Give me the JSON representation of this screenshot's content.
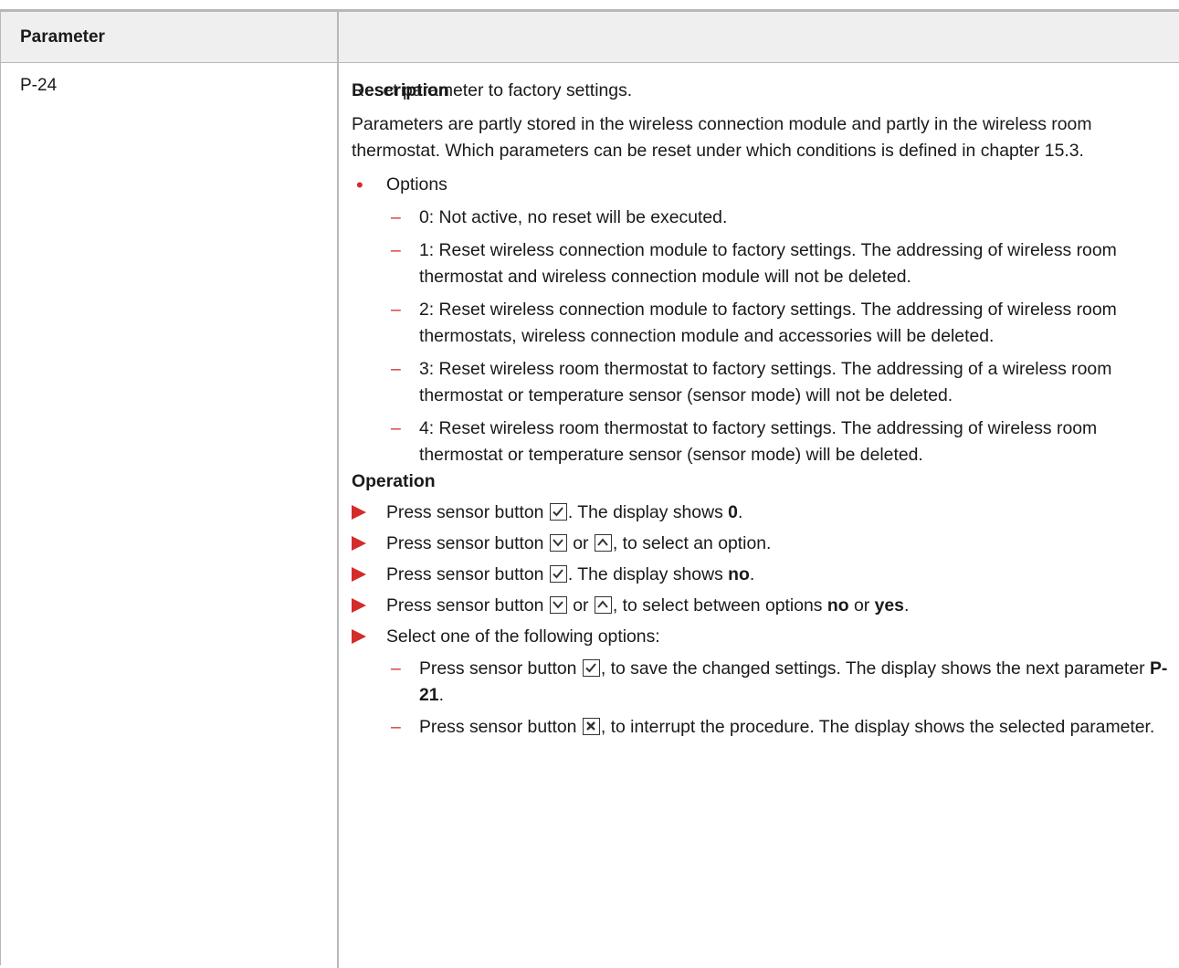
{
  "table": {
    "headers": {
      "parameter": "Parameter",
      "description": "Description"
    },
    "row": {
      "parameter": "P-24",
      "intro": "Reset parameter to factory settings.",
      "detail": "Parameters are partly stored in the wireless connection module and partly in the wireless room thermostat. Which parameters can be reset under which conditions is defined in chapter 15.3.",
      "options_label": "Options",
      "options": [
        "0: Not active, no reset will be executed.",
        "1: Reset wireless connection module to factory settings. The addressing of wireless room thermostat and wireless connection module will not be deleted.",
        "2: Reset wireless connection module to factory settings. The addressing of wireless room thermostats, wireless connection module and accessories will be deleted.",
        "3: Reset wireless room thermostat to factory settings. The addressing of a wireless room thermostat or temperature sensor (sensor mode) will not be deleted.",
        "4: Reset wireless room thermostat to factory settings. The addressing of wireless room thermostat or temperature sensor (sensor mode) will be deleted."
      ],
      "operation": {
        "heading": "Operation",
        "step1_a": "Press sensor button ",
        "step1_b": ". The display shows ",
        "step1_val": "0",
        "step1_c": ".",
        "step2_a": "Press sensor button ",
        "step2_b": " or ",
        "step2_c": ", to select an option.",
        "step3_a": "Press sensor button ",
        "step3_b": ". The display shows ",
        "step3_val": "no",
        "step3_c": ".",
        "step4_a": "Press sensor button ",
        "step4_b": " or ",
        "step4_c": ", to select between options ",
        "step4_no": "no",
        "step4_or": " or ",
        "step4_yes": "yes",
        "step4_end": ".",
        "step5": "Select one of the following options:",
        "sub1_a": "Press sensor button ",
        "sub1_b": ", to save the changed settings. The display shows the next parameter ",
        "sub1_param": "P-21",
        "sub1_end": ".",
        "sub2_a": "Press sensor button ",
        "sub2_b": ", to interrupt the procedure. The display shows the selected parameter."
      }
    }
  },
  "icons": {
    "check": "check-button-icon",
    "down": "down-button-icon",
    "up": "up-button-icon",
    "cancel": "cancel-button-icon"
  },
  "colors": {
    "accent": "#d42b2b",
    "header_bg": "#efefef",
    "border": "#b8b8b8"
  }
}
